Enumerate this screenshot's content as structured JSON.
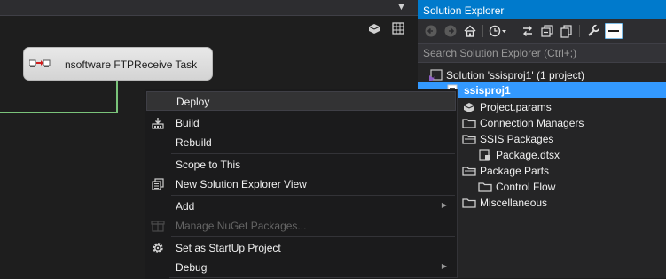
{
  "designer": {
    "task_label": "nsoftware FTPReceive Task"
  },
  "solution_explorer": {
    "title": "Solution Explorer",
    "search_placeholder": "Search Solution Explorer (Ctrl+;)",
    "tree": [
      {
        "label": "Solution 'ssisproj1' (1 project)",
        "icon": "solution-icon"
      },
      {
        "label": "ssisproj1",
        "icon": "project-icon",
        "selected": true
      },
      {
        "label": "Project.params",
        "icon": "params-icon"
      },
      {
        "label": "Connection Managers",
        "icon": "folder-icon"
      },
      {
        "label": "SSIS Packages",
        "icon": "folder-icon"
      },
      {
        "label": "Package.dtsx",
        "icon": "package-icon"
      },
      {
        "label": "Package Parts",
        "icon": "folder-icon"
      },
      {
        "label": "Control Flow",
        "icon": "folder-icon"
      },
      {
        "label": "Miscellaneous",
        "icon": "folder-icon"
      }
    ]
  },
  "context_menu": {
    "items": [
      {
        "label": "Deploy",
        "state": "hover"
      },
      {
        "label": "Build",
        "icon": "build-icon"
      },
      {
        "label": "Rebuild"
      },
      {
        "label": "Scope to This"
      },
      {
        "label": "New Solution Explorer View",
        "icon": "new-view-icon"
      },
      {
        "label": "Add",
        "submenu": true
      },
      {
        "label": "Manage NuGet Packages...",
        "icon": "nuget-icon",
        "disabled": true
      },
      {
        "label": "Set as StartUp Project",
        "icon": "gear-icon"
      },
      {
        "label": "Debug",
        "submenu": true
      }
    ]
  },
  "colors": {
    "accent": "#007acc",
    "selection": "#3399ff",
    "flow_line": "#7ac37a"
  }
}
